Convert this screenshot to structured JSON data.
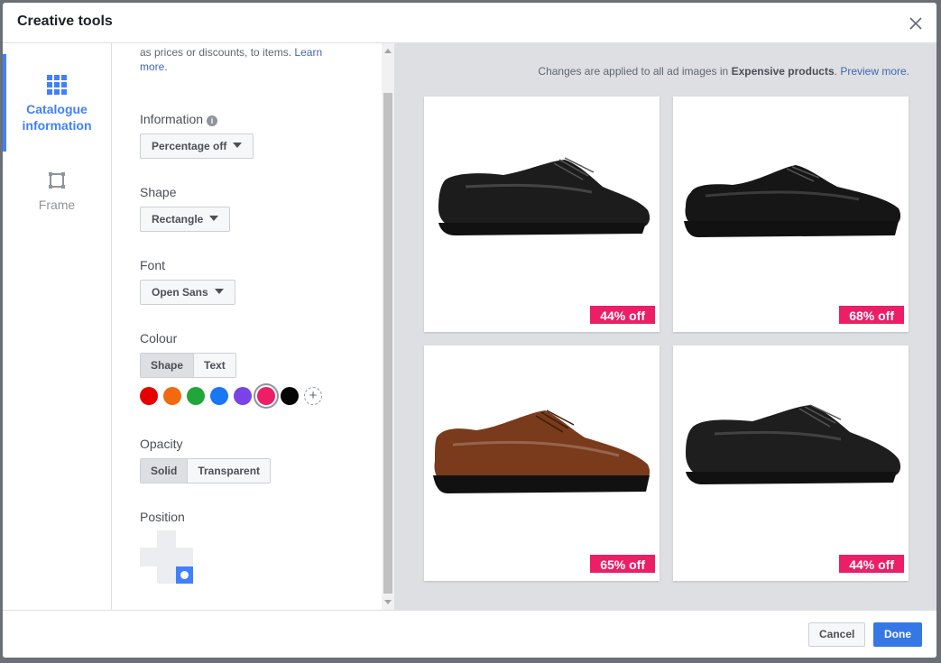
{
  "dialog": {
    "title": "Creative tools",
    "close_icon": "close-icon"
  },
  "nav": {
    "items": [
      {
        "label": "Catalogue information",
        "icon": "grid-icon",
        "active": true
      },
      {
        "label": "Frame",
        "icon": "frame-icon",
        "active": false
      }
    ]
  },
  "settings": {
    "intro_text": "as prices or discounts, to items.",
    "intro_link": "Learn more.",
    "information": {
      "label": "Information",
      "value": "Percentage off"
    },
    "shape": {
      "label": "Shape",
      "value": "Rectangle"
    },
    "font": {
      "label": "Font",
      "value": "Open Sans"
    },
    "colour": {
      "label": "Colour",
      "tabs": [
        "Shape",
        "Text"
      ],
      "selected_tab": "Shape",
      "swatches": [
        "#e60000",
        "#f26a0f",
        "#20a639",
        "#1877f2",
        "#7a43e6",
        "#ec1f66",
        "#050505"
      ],
      "selected_swatch": "#ec1f66"
    },
    "opacity": {
      "label": "Opacity",
      "options": [
        "Solid",
        "Transparent"
      ],
      "selected": "Solid"
    },
    "position": {
      "label": "Position",
      "selected": "bottom-right"
    }
  },
  "preview": {
    "note_prefix": "Changes are applied to all ad images in",
    "set_name": "Expensive products",
    "note_link": "Preview more.",
    "products": [
      {
        "badge": "44% off",
        "shoe_color": "#1c1c1c"
      },
      {
        "badge": "68% off",
        "shoe_color": "#161616"
      },
      {
        "badge": "65% off",
        "shoe_color": "#7a3a1c"
      },
      {
        "badge": "44% off",
        "shoe_color": "#1e1e1e"
      }
    ],
    "badge_color": "#ec1f66"
  },
  "footer": {
    "cancel_label": "Cancel",
    "done_label": "Done"
  }
}
